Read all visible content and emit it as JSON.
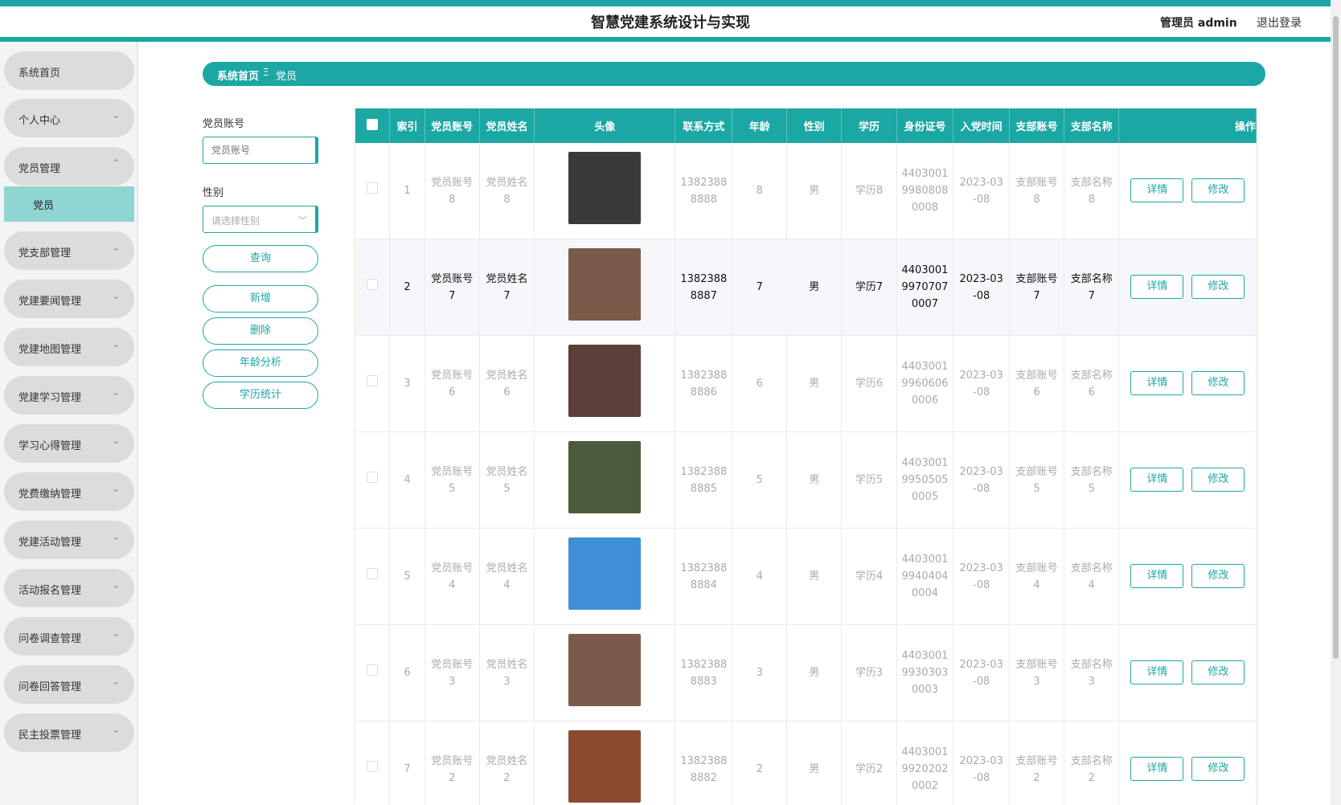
{
  "header": {
    "title": "智慧党建系统设计与实现",
    "admin_label": "管理员 admin",
    "logout": "退出登录"
  },
  "sidebar": {
    "items": [
      {
        "label": "系统首页",
        "chevron": ""
      },
      {
        "label": "个人中心",
        "chevron": "⌄"
      },
      {
        "label": "党员管理",
        "chevron": "⌃"
      },
      {
        "label": "党支部管理",
        "chevron": "⌄"
      },
      {
        "label": "党建要闻管理",
        "chevron": "⌄"
      },
      {
        "label": "党建地图管理",
        "chevron": "⌄"
      },
      {
        "label": "党建学习管理",
        "chevron": "⌄"
      },
      {
        "label": "学习心得管理",
        "chevron": "⌄"
      },
      {
        "label": "党费缴纳管理",
        "chevron": "⌄"
      },
      {
        "label": "党建活动管理",
        "chevron": "⌄"
      },
      {
        "label": "活动报名管理",
        "chevron": "⌄"
      },
      {
        "label": "问卷调查管理",
        "chevron": "⌄"
      },
      {
        "label": "问卷回答管理",
        "chevron": "⌄"
      },
      {
        "label": "民主投票管理",
        "chevron": "⌄"
      }
    ],
    "sub_item": "党员"
  },
  "breadcrumb": {
    "home": "系统首页",
    "sep": "Ξ",
    "current": "党员"
  },
  "filters": {
    "account_label": "党员账号",
    "account_placeholder": "党员账号",
    "gender_label": "性别",
    "gender_placeholder": "请选择性别",
    "buttons": {
      "query": "查询",
      "add": "新增",
      "delete": "删除",
      "age": "年龄分析",
      "edu": "学历统计"
    }
  },
  "table": {
    "headers": [
      "索引",
      "党员账号",
      "党员姓名",
      "头像",
      "联系方式",
      "年龄",
      "性别",
      "学历",
      "身份证号",
      "入党时间",
      "支部账号",
      "支部名称",
      "操作"
    ],
    "detail_label": "详情",
    "edit_label": "修改",
    "rows": [
      {
        "index": "1",
        "account": "党员账号8",
        "name": "党员姓名8",
        "phone": "13823888888",
        "age": "8",
        "gender": "男",
        "edu": "学历8",
        "id": "440300199808080008",
        "date": "2023-03-08",
        "branch_acc": "支部账号8",
        "branch_name": "支部名称8",
        "avatar_color": "#3a3a3a"
      },
      {
        "index": "2",
        "account": "党员账号7",
        "name": "党员姓名7",
        "phone": "13823888887",
        "age": "7",
        "gender": "男",
        "edu": "学历7",
        "id": "440300199707070007",
        "date": "2023-03-08",
        "branch_acc": "支部账号7",
        "branch_name": "支部名称7",
        "avatar_color": "#7a5a48"
      },
      {
        "index": "3",
        "account": "党员账号6",
        "name": "党员姓名6",
        "phone": "13823888886",
        "age": "6",
        "gender": "男",
        "edu": "学历6",
        "id": "440300199606060006",
        "date": "2023-03-08",
        "branch_acc": "支部账号6",
        "branch_name": "支部名称6",
        "avatar_color": "#5a4038"
      },
      {
        "index": "4",
        "account": "党员账号5",
        "name": "党员姓名5",
        "phone": "13823888885",
        "age": "5",
        "gender": "男",
        "edu": "学历5",
        "id": "440300199505050005",
        "date": "2023-03-08",
        "branch_acc": "支部账号5",
        "branch_name": "支部名称5",
        "avatar_color": "#4d5a3a"
      },
      {
        "index": "5",
        "account": "党员账号4",
        "name": "党员姓名4",
        "phone": "13823888884",
        "age": "4",
        "gender": "男",
        "edu": "学历4",
        "id": "440300199404040004",
        "date": "2023-03-08",
        "branch_acc": "支部账号4",
        "branch_name": "支部名称4",
        "avatar_color": "#3f8fd8"
      },
      {
        "index": "6",
        "account": "党员账号3",
        "name": "党员姓名3",
        "phone": "13823888883",
        "age": "3",
        "gender": "男",
        "edu": "学历3",
        "id": "440300199303030003",
        "date": "2023-03-08",
        "branch_acc": "支部账号3",
        "branch_name": "支部名称3",
        "avatar_color": "#7a5a48"
      },
      {
        "index": "7",
        "account": "党员账号2",
        "name": "党员姓名2",
        "phone": "13823888882",
        "age": "2",
        "gender": "男",
        "edu": "学历2",
        "id": "440300199202020002",
        "date": "2023-03-08",
        "branch_acc": "支部账号2",
        "branch_name": "支部名称2",
        "avatar_color": "#8a4a30"
      }
    ]
  },
  "colors": {
    "accent": "#1ba7a4",
    "sub_active": "#8fd6d3"
  }
}
